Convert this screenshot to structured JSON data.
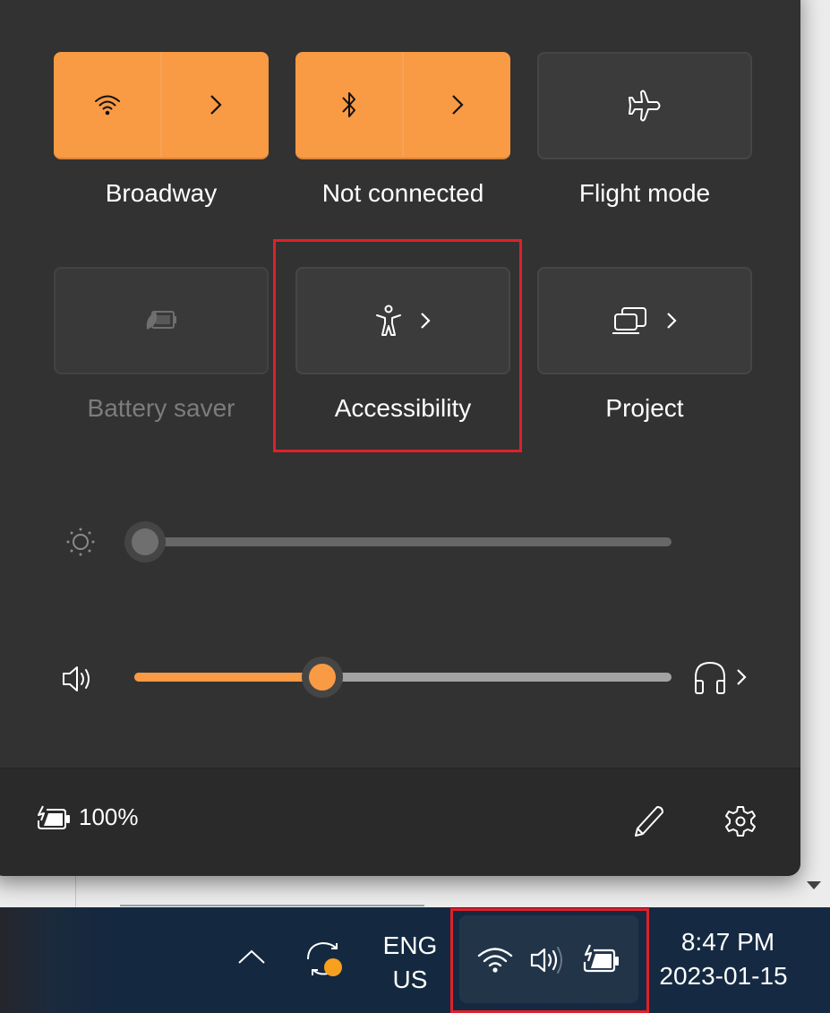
{
  "quick_settings": {
    "tiles": [
      {
        "id": "wifi",
        "label": "Broadway",
        "state": "on",
        "icon": "wifi-icon",
        "has_expand": true
      },
      {
        "id": "bluetooth",
        "label": "Not connected",
        "state": "on",
        "icon": "bluetooth-icon",
        "has_expand": true
      },
      {
        "id": "flight-mode",
        "label": "Flight mode",
        "state": "off",
        "icon": "airplane-icon",
        "has_expand": false
      },
      {
        "id": "battery-saver",
        "label": "Battery saver",
        "state": "disabled",
        "icon": "battery-saver-icon",
        "has_expand": false
      },
      {
        "id": "accessibility",
        "label": "Accessibility",
        "state": "off",
        "icon": "accessibility-icon",
        "has_expand": true
      },
      {
        "id": "project",
        "label": "Project",
        "state": "off",
        "icon": "project-icon",
        "has_expand": true
      }
    ],
    "brightness": {
      "icon": "brightness-icon",
      "value_percent": 0,
      "state": "disabled"
    },
    "volume": {
      "icon": "speaker-icon",
      "value_percent": 35,
      "output_icon": "headphones-icon"
    },
    "battery": {
      "icon": "battery-charging-icon",
      "text": "100%"
    },
    "footer_actions": [
      {
        "id": "edit",
        "icon": "pencil-icon"
      },
      {
        "id": "settings",
        "icon": "gear-icon"
      }
    ],
    "highlight": "accessibility"
  },
  "taskbar": {
    "overflow_icon": "chevron-up-icon",
    "sync_icon": "sync-icon",
    "language": {
      "line1": "ENG",
      "line2": "US"
    },
    "tray_icons": [
      "wifi-icon",
      "speaker-icon",
      "battery-charging-icon"
    ],
    "clock": {
      "time": "8:47 PM",
      "date": "2023-01-15"
    }
  },
  "colors": {
    "accent": "#f99a44",
    "panel_bg": "#323232",
    "footer_bg": "#2a2a2a",
    "taskbar_bg": "#152a42",
    "highlight_box": "#e0202a",
    "notification_dot": "#f7a01e"
  }
}
